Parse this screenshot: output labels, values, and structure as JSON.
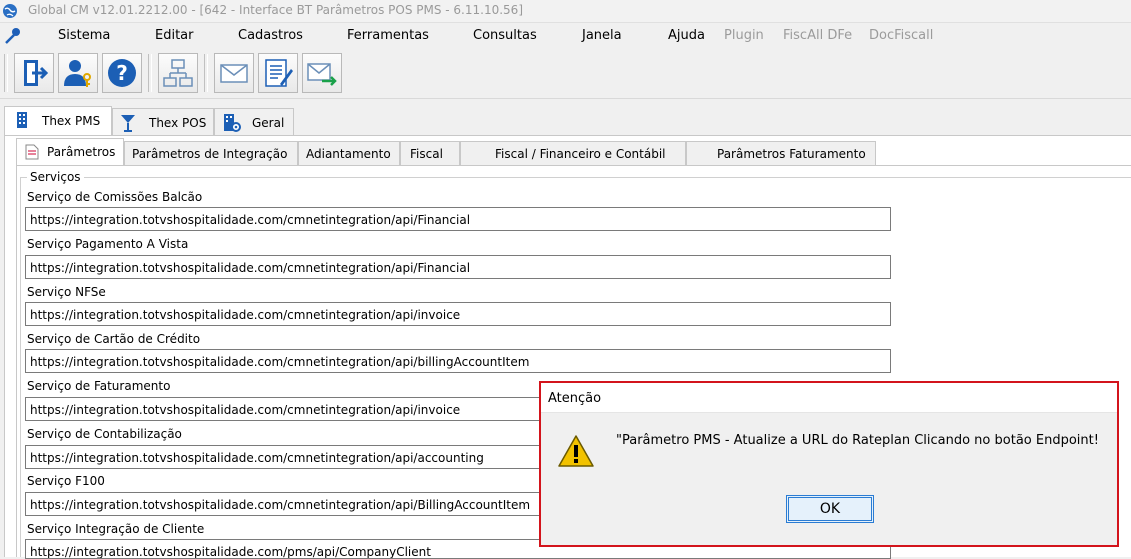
{
  "window": {
    "title": "Global CM v12.01.2212.00 - [642 - Interface BT Parâmetros POS PMS - 6.11.10.56]"
  },
  "menu": {
    "items": [
      {
        "label": "Sistema",
        "enabled": true
      },
      {
        "label": "Editar",
        "enabled": true
      },
      {
        "label": "Cadastros",
        "enabled": true
      },
      {
        "label": "Ferramentas",
        "enabled": true
      },
      {
        "label": "Consultas",
        "enabled": true
      },
      {
        "label": "Janela",
        "enabled": true
      },
      {
        "label": "Ajuda",
        "enabled": true
      },
      {
        "label": "Plugin",
        "enabled": false
      },
      {
        "label": "FiscAll DFe",
        "enabled": false
      },
      {
        "label": "DocFiscall",
        "enabled": false
      }
    ]
  },
  "toolbar": {
    "icons": [
      "exit-door-icon",
      "user-key-icon",
      "help-icon",
      "network-icon",
      "mail-icon",
      "document-edit-icon",
      "mail-forward-icon"
    ]
  },
  "outer_tabs": [
    {
      "label": "Thex PMS",
      "icon": "building-icon",
      "active": true
    },
    {
      "label": "Thex POS",
      "icon": "cocktail-glass-icon",
      "active": false
    },
    {
      "label": "Geral",
      "icon": "building-gear-icon",
      "active": false
    }
  ],
  "inner_tabs": [
    {
      "label": "Parâmetros",
      "active": true
    },
    {
      "label": "Parâmetros de Integração",
      "active": false
    },
    {
      "label": "Adiantamento",
      "active": false
    },
    {
      "label": "Fiscal",
      "active": false
    },
    {
      "label": "Fiscal / Financeiro e Contábil",
      "active": false
    },
    {
      "label": "Parâmetros Faturamento",
      "active": false
    }
  ],
  "services": {
    "group_title": "Serviços",
    "fields": [
      {
        "label": "Serviço de Comissões Balcão",
        "value": "https://integration.totvshospitalidade.com/cmnetintegration/api/Financial"
      },
      {
        "label": "Serviço Pagamento A Vista",
        "value": "https://integration.totvshospitalidade.com/cmnetintegration/api/Financial"
      },
      {
        "label": "Serviço NFSe",
        "value": "https://integration.totvshospitalidade.com/cmnetintegration/api/invoice"
      },
      {
        "label": "Serviço de Cartão de Crédito",
        "value": "https://integration.totvshospitalidade.com/cmnetintegration/api/billingAccountItem"
      },
      {
        "label": "Serviço de Faturamento",
        "value": "https://integration.totvshospitalidade.com/cmnetintegration/api/invoice"
      },
      {
        "label": "Serviço de Contabilização",
        "value": "https://integration.totvshospitalidade.com/cmnetintegration/api/accounting"
      },
      {
        "label": "Serviço F100",
        "value": "https://integration.totvshospitalidade.com/cmnetintegration/api/BillingAccountItem"
      },
      {
        "label": "Serviço Integração de Cliente",
        "value": "https://integration.totvshospitalidade.com/pms/api/CompanyClient"
      }
    ]
  },
  "dialog": {
    "title": "Atenção",
    "message": "\"Parâmetro PMS - Atualize a URL do Rateplan Clicando no botão Endpoint!",
    "ok_label": "OK",
    "icon": "warning-icon",
    "border_color": "#d3141c"
  }
}
